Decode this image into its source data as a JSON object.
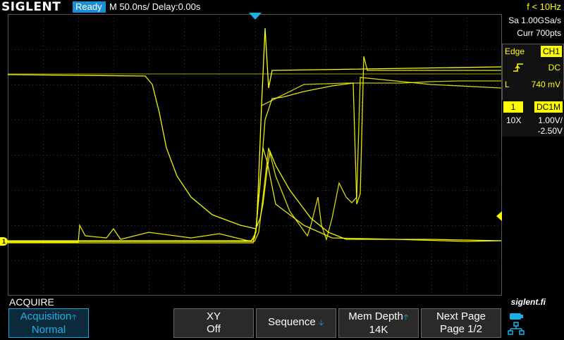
{
  "header": {
    "brand": "SIGLENT",
    "status": "Ready",
    "timebase": "M 50.0ns/",
    "delay": "Delay:0.00s",
    "trigger_freq": "f < 10Hz"
  },
  "acquisition_info": {
    "sample_rate": "Sa 1.00GSa/s",
    "points": "Curr 700pts"
  },
  "trigger": {
    "type": "Edge",
    "source": "CH1",
    "slope_icon": "rising-edge-icon",
    "coupling": "DC",
    "level_label": "L",
    "level_value": "740 mV"
  },
  "channel": {
    "number": "1",
    "coupling": "DC1M",
    "probe": "10X",
    "volts_div": "1.00V/",
    "offset": "-2.50V",
    "marker_label": "1",
    "color": "#ffff00"
  },
  "menu": {
    "title": "ACQUIRE",
    "brand_url": "siglent.fi",
    "softkeys": [
      {
        "line1": "Acquisition",
        "line2": "Normal",
        "arrow": "up"
      },
      {
        "line1": "XY",
        "line2": "Off",
        "arrow": ""
      },
      {
        "line1": "Sequence",
        "line2": "",
        "arrow": "down"
      },
      {
        "line1": "Mem Depth",
        "line2": "14K",
        "arrow": "up"
      },
      {
        "line1": "Next Page",
        "line2": "Page 1/2",
        "arrow": ""
      }
    ]
  },
  "colors": {
    "trace": "#ffff00",
    "accent": "#1a8fd6",
    "grid": "#3a3a3a"
  }
}
